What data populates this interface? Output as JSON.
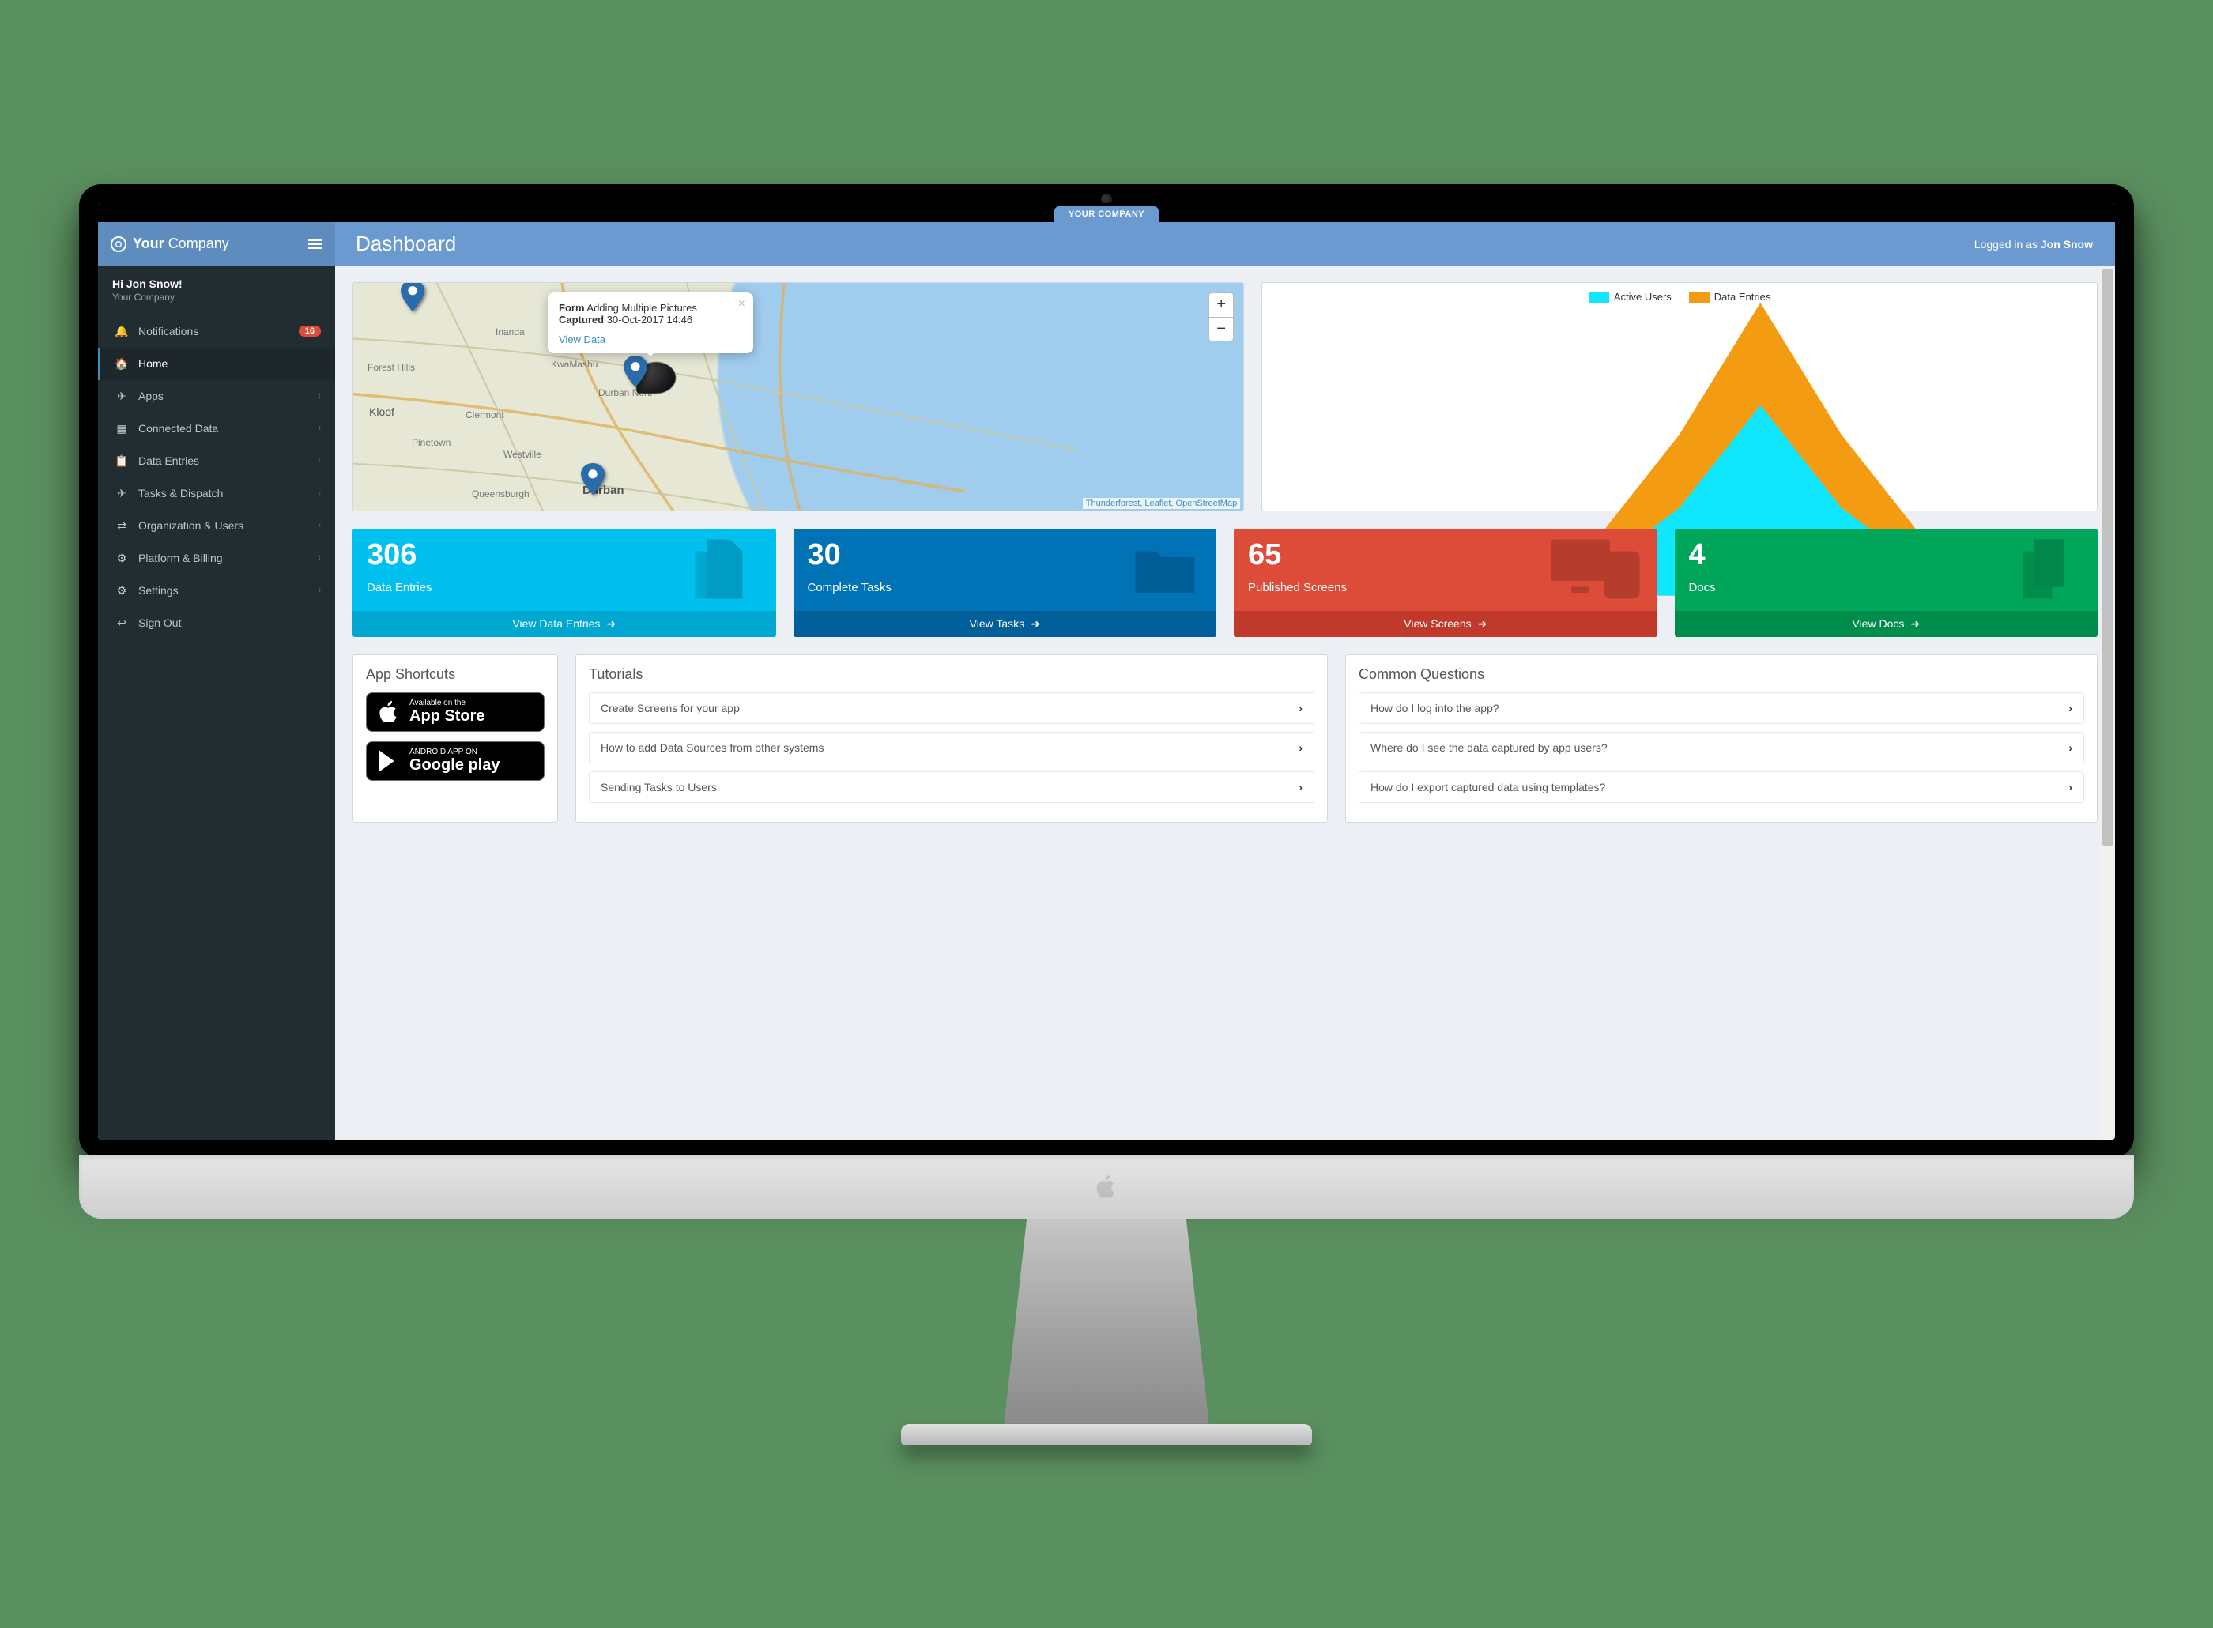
{
  "browser_tab": "YOUR COMPANY",
  "brand": {
    "bold": "Your",
    "light": "Company"
  },
  "page_title": "Dashboard",
  "logged_in_text": "Logged in as ",
  "logged_in_user": "Jon Snow",
  "user_panel": {
    "greeting": "Hi Jon Snow!",
    "company": "Your Company"
  },
  "sidebar": {
    "items": [
      {
        "icon": "bell-icon",
        "label": "Notifications",
        "badge": "16",
        "expandable": false,
        "classes": "nav-notif"
      },
      {
        "icon": "home-icon",
        "label": "Home",
        "active": true
      },
      {
        "icon": "plane-icon",
        "label": "Apps",
        "expandable": true
      },
      {
        "icon": "grid-icon",
        "label": "Connected Data",
        "expandable": true
      },
      {
        "icon": "list-icon",
        "label": "Data Entries",
        "expandable": true
      },
      {
        "icon": "send-icon",
        "label": "Tasks & Dispatch",
        "expandable": true
      },
      {
        "icon": "org-icon",
        "label": "Organization & Users",
        "expandable": true
      },
      {
        "icon": "gear-icon",
        "label": "Platform & Billing",
        "expandable": true
      },
      {
        "icon": "sliders-icon",
        "label": "Settings",
        "expandable": true
      },
      {
        "icon": "signout-icon",
        "label": "Sign Out"
      }
    ]
  },
  "map": {
    "popup": {
      "form_label": "Form",
      "form_value": "Adding Multiple Pictures",
      "captured_label": "Captured",
      "captured_value": "30-Oct-2017 14:46",
      "link": "View Data"
    },
    "labels": [
      "Inanda",
      "KwaMashu",
      "Forest Hills",
      "Kloof",
      "Clermont",
      "Durban North",
      "Pinetown",
      "Westville",
      "Queensburgh",
      "Durban"
    ],
    "attribution": "Thunderforest, Leaflet, OpenStreetMap"
  },
  "chart": {
    "legend": [
      {
        "name": "Active Users",
        "color": "#11e6ff"
      },
      {
        "name": "Data Entries",
        "color": "#f39c12"
      }
    ]
  },
  "chart_data": {
    "type": "area",
    "x": [
      0,
      1,
      2,
      3,
      4,
      5,
      6,
      7,
      8,
      9,
      10
    ],
    "series": [
      {
        "name": "Data Entries",
        "color": "#f39c12",
        "values": [
          0,
          1,
          3,
          8,
          20,
          55,
          100,
          55,
          20,
          8,
          1
        ]
      },
      {
        "name": "Active Users",
        "color": "#11e6ff",
        "values": [
          0,
          0,
          1,
          3,
          9,
          30,
          65,
          30,
          9,
          3,
          0
        ]
      }
    ],
    "ylim": [
      0,
      100
    ]
  },
  "stats": [
    {
      "value": "306",
      "label": "Data Entries",
      "footer": "View Data Entries",
      "color": "cyan",
      "icon": "file-icon"
    },
    {
      "value": "30",
      "label": "Complete Tasks",
      "footer": "View Tasks",
      "color": "blue",
      "icon": "folder-icon"
    },
    {
      "value": "65",
      "label": "Published Screens",
      "footer": "View Screens",
      "color": "red",
      "icon": "screens-icon"
    },
    {
      "value": "4",
      "label": "Docs",
      "footer": "View Docs",
      "color": "green",
      "icon": "docs-icon"
    }
  ],
  "shortcuts": {
    "title": "App Shortcuts",
    "appstore": {
      "line1": "Available on the",
      "line2": "App Store"
    },
    "play": {
      "line1": "ANDROID APP ON",
      "line2": "Google play"
    }
  },
  "tutorials": {
    "title": "Tutorials",
    "items": [
      "Create Screens for your app",
      "How to add Data Sources from other systems",
      "Sending Tasks to Users"
    ]
  },
  "questions": {
    "title": "Common Questions",
    "items": [
      "How do I log into the app?",
      "Where do I see the data captured by app users?",
      "How do I export captured data using templates?"
    ]
  }
}
